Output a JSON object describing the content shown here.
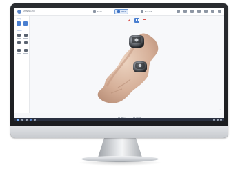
{
  "app": {
    "logo_text": "SHINING 3D",
    "steps": [
      {
        "label": "Scan",
        "active": false
      },
      {
        "label": "Edit",
        "active": true
      },
      {
        "label": "Export",
        "active": false
      }
    ],
    "top_icons": [
      "home-icon",
      "folder-icon",
      "settings-icon",
      "help-icon",
      "minimize-icon",
      "maximize-icon",
      "close-icon"
    ]
  },
  "sidebar": {
    "section1": "Crop",
    "section2": "Tools",
    "tools": [
      "brush-icon",
      "fill-icon",
      "zoom-icon",
      "frame-icon",
      "person-icon",
      "layers-icon"
    ]
  },
  "viewport": {
    "view_tools": [
      "jaw-view-icon",
      "select-view-icon",
      "section-view-icon"
    ],
    "prev_label": "Prev",
    "next_label": "Next",
    "status": "..."
  },
  "colors": {
    "accent": "#4a7fd0",
    "model_tissue": "#d8b49c",
    "scan_body": "#2b2d30"
  }
}
